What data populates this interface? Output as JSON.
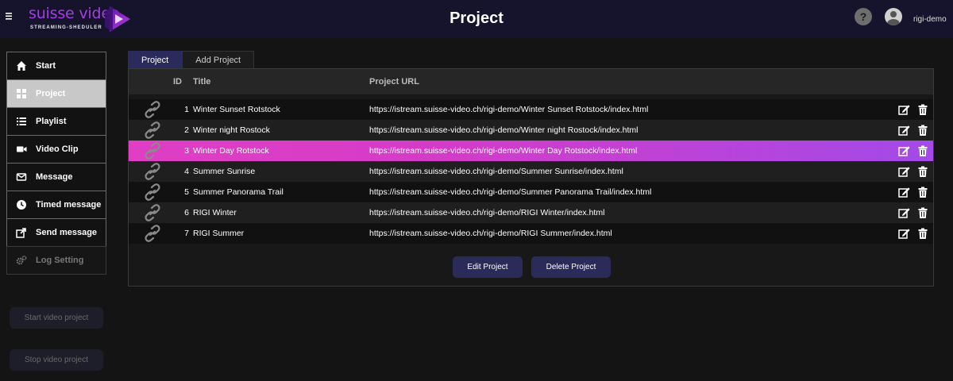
{
  "header": {
    "menu_icon": "hamburger-icon",
    "logo_text": "suisse video",
    "logo_subtitle": "STREAMING-SHEDULER",
    "title": "Project",
    "help_label": "?",
    "username": "rigi-demo"
  },
  "sidebar": {
    "items": [
      {
        "label": "Start",
        "icon": "home-icon",
        "state": "normal"
      },
      {
        "label": "Project",
        "icon": "grid-icon",
        "state": "active"
      },
      {
        "label": "Playlist",
        "icon": "list-icon",
        "state": "normal"
      },
      {
        "label": "Video Clip",
        "icon": "video-camera-icon",
        "state": "normal"
      },
      {
        "label": "Message",
        "icon": "envelope-icon",
        "state": "normal"
      },
      {
        "label": "Timed message",
        "icon": "clock-icon",
        "state": "normal"
      },
      {
        "label": "Send message",
        "icon": "share-icon",
        "state": "normal"
      },
      {
        "label": "Log Setting",
        "icon": "gears-icon",
        "state": "disabled"
      }
    ],
    "start_button": "Start video project",
    "stop_button": "Stop video project"
  },
  "tabs": [
    {
      "label": "Project",
      "active": true
    },
    {
      "label": "Add Project",
      "active": false
    }
  ],
  "table": {
    "columns": {
      "id": "ID",
      "title": "Title",
      "url": "Project URL"
    },
    "rows": [
      {
        "id": "1",
        "title": "Winter Sunset Rotstock",
        "url": "https://istream.suisse-video.ch/rigi-demo/Winter Sunset Rotstock/index.html",
        "highlighted": false
      },
      {
        "id": "2",
        "title": "Winter night Rostock",
        "url": "https://istream.suisse-video.ch/rigi-demo/Winter night Rostock/index.html",
        "highlighted": false
      },
      {
        "id": "3",
        "title": "Winter Day Rotstock",
        "url": "https://istream.suisse-video.ch/rigi-demo/Winter Day Rotstock/index.html",
        "highlighted": true
      },
      {
        "id": "4",
        "title": "Summer Sunrise",
        "url": "https://istream.suisse-video.ch/rigi-demo/Summer Sunrise/index.html",
        "highlighted": false
      },
      {
        "id": "5",
        "title": "Summer Panorama Trail",
        "url": "https://istream.suisse-video.ch/rigi-demo/Summer Panorama Trail/index.html",
        "highlighted": false
      },
      {
        "id": "6",
        "title": "RIGI Winter",
        "url": "https://istream.suisse-video.ch/rigi-demo/RIGI Winter/index.html",
        "highlighted": false
      },
      {
        "id": "7",
        "title": "RIGI Summer",
        "url": "https://istream.suisse-video.ch/rigi-demo/RIGI Summer/index.html",
        "highlighted": false
      }
    ]
  },
  "actions": {
    "edit": "Edit Project",
    "delete": "Delete Project"
  },
  "colors": {
    "header_bg": "#16142c",
    "accent": "#a73be6",
    "highlight_start": "#e03ec4",
    "highlight_end": "#a34ae8",
    "button_bg": "#2b2b5a"
  }
}
